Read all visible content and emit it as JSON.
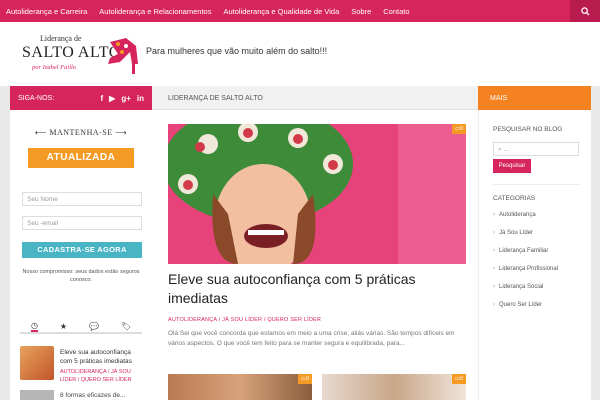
{
  "nav": {
    "items": [
      "Autoliderança e Carreira",
      "Autoliderança e Relacionamentos",
      "Autoliderança e Qualidade de Vida",
      "Sobre",
      "Contato"
    ],
    "search_icon": "search-icon"
  },
  "header": {
    "logo_line1": "Liderança de",
    "logo_line2": "SALTO ALTO",
    "logo_line3": "por Izabel Faillo",
    "tagline": "Para mulheres que vão muito além do salto!!!"
  },
  "left": {
    "follow_label": "SIGA-NOS:",
    "social": [
      "f",
      "▶",
      "g+",
      "in"
    ],
    "keep_title": "MANTENHA-SE",
    "updated_title": "ATUALIZADA",
    "name_placeholder": "Seu Nome",
    "email_placeholder": "Seu -email",
    "signup_label": "CADASTRA-SE AGORA",
    "commitment": "Nosso compromisso: seus dados estão seguros conosco.",
    "tabs": [
      "◷",
      "★",
      "💬",
      "🏷"
    ],
    "mini_post_title": "Eleve sua autoconfiança com 5 práticas imediatas",
    "mini_post_cats": "AUTOLIDERANÇA / JÁ SOU LÍDER / QUERO SER LÍDER",
    "next_mini_title": "8 formas eficazes de..."
  },
  "main": {
    "breadcrumb": "LIDERANÇA DE SALTO ALTO",
    "hero_comments": "0",
    "post_title": "Eleve sua autoconfiança com 5 práticas imediatas",
    "post_cats": "AUTOLIDERANÇA / JÁ SOU LÍDER / QUERO SER LÍDER",
    "excerpt": "Olá Sei que você concorda que estamos em meio a uma crise, aliás várias. São tempos difíceis em vários aspectos.   O que você tem feito para se manter segura e equilibrada, para...",
    "thumb2_comments": "0",
    "thumb3_comments": "0"
  },
  "right": {
    "mais_label": "MAIS",
    "search_heading": "PESQUISAR NO BLOG",
    "search_placeholder": "...",
    "search_button": "Pesquisar",
    "categories_heading": "CATEGORIAS",
    "categories": [
      "Autoliderança",
      "Já Sou Líder",
      "Liderança Familiar",
      "Liderança Profissional",
      "Liderança Social",
      "Quero Ser Líder"
    ]
  }
}
